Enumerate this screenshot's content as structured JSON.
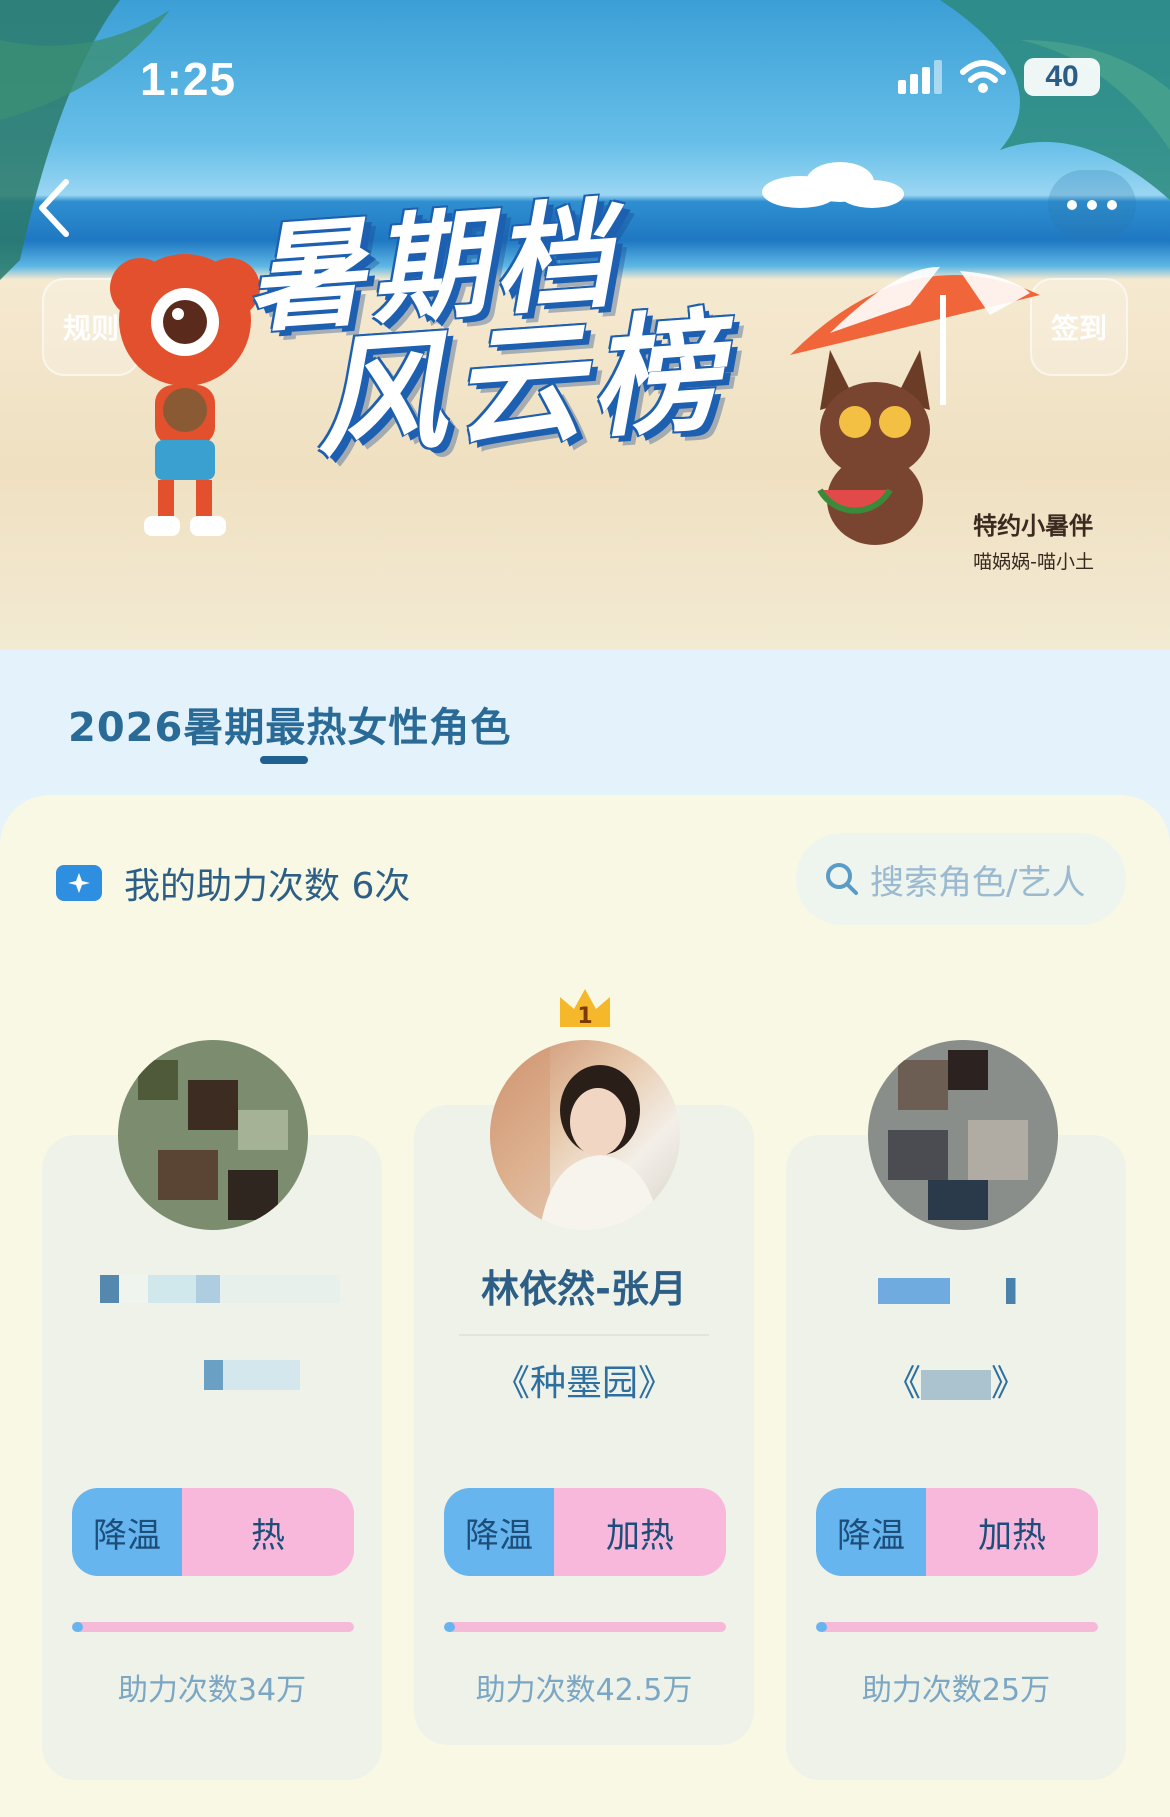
{
  "status": {
    "time": "1:25",
    "battery": "40"
  },
  "nav": {
    "rules": "规则",
    "checkin": "签到"
  },
  "hero": {
    "title_line1": "暑期档",
    "title_line2": "风云榜",
    "sponsor_label": "特约小暑伴",
    "sponsor_name": "喵娲娲-喵小土"
  },
  "tab": {
    "title": "2026暑期最热女性角色"
  },
  "boost": {
    "label": "我的助力次数 6次"
  },
  "search": {
    "placeholder": "搜索角色/艺人"
  },
  "cards": [
    {
      "rank": "",
      "name": "",
      "work": "",
      "cool": "降温",
      "heat": "热",
      "count": "助力次数34万",
      "progress": 0.04
    },
    {
      "rank": "1",
      "name": "林依然-张月",
      "work": "《种墨园》",
      "cool": "降温",
      "heat": "加热",
      "count": "助力次数42.5万",
      "progress": 0.04
    },
    {
      "rank": "",
      "name": "",
      "work": "《",
      "work_end": "》",
      "cool": "降温",
      "heat": "加热",
      "count": "助力次数25万",
      "progress": 0.04
    }
  ],
  "colors": {
    "accent": "#2d5e86",
    "cool": "#66b5ef",
    "heat": "#f7b8dc"
  }
}
